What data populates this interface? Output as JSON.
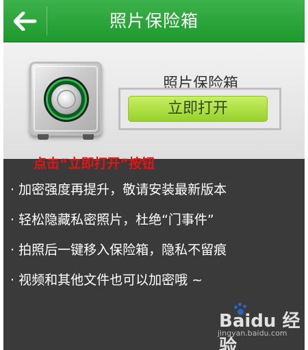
{
  "header": {
    "title": "照片保险箱",
    "back_icon": "back-arrow-icon"
  },
  "hero": {
    "safe_icon": "safe-icon",
    "label": "照片保险箱",
    "open_button_label": "立即打开"
  },
  "panel": {
    "instruction": "点击“立即打开”按钮",
    "bullets": [
      "· 加密强度再提升，敬请安装最新版本",
      "· 轻松隐藏私密照片，杜绝“门事件”",
      "· 拍照后一键移入保险箱，隐私不留痕",
      "· 视频和其他文件也可以加密哦 ~"
    ]
  },
  "watermark": {
    "main": "Baidu 经验",
    "sub": "jingyan.baidu.com"
  },
  "colors": {
    "header_green": "#2aa83b",
    "button_green": "#a8dc3a",
    "panel_bg": "#3a3a3a",
    "instruction_red": "#e01515"
  }
}
